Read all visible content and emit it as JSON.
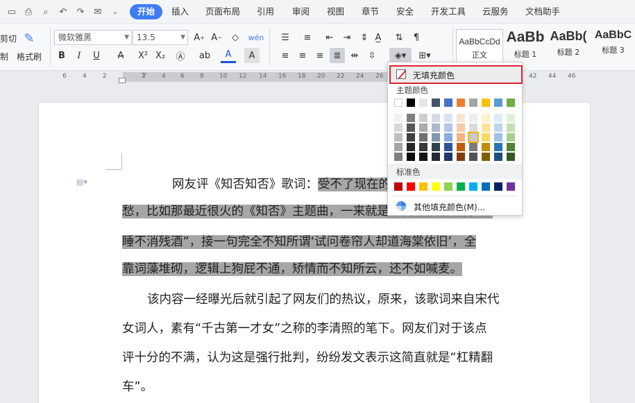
{
  "menubar": {
    "tabs": [
      "开始",
      "插入",
      "页面布局",
      "引用",
      "审阅",
      "视图",
      "章节",
      "安全",
      "开发工具",
      "云服务",
      "文档助手"
    ],
    "active_tab": "开始"
  },
  "ribbon": {
    "clipboard": {
      "cut_label": "剪切",
      "format_painter_label": "格式刷"
    },
    "font": {
      "family": "微软雅黑",
      "size": "13.5"
    },
    "styles": [
      {
        "sample": "AaBbCcDd",
        "name": "正文"
      },
      {
        "sample": "AaBb",
        "name": "标题 1"
      },
      {
        "sample": "AaBb(",
        "name": "标题 2"
      },
      {
        "sample": "AaBbC",
        "name": "标题 3"
      }
    ]
  },
  "ruler": {
    "numbers": [
      "6",
      "4",
      "2",
      "2",
      "4",
      "6",
      "8",
      "10",
      "12",
      "14",
      "16",
      "18",
      "20",
      "22",
      "24",
      "26",
      "28",
      "30",
      "32",
      "34",
      "36",
      "38",
      "40",
      "42",
      "44",
      "46"
    ]
  },
  "document": {
    "lines": [
      "网友评《知否知否》歌词：受不了现在的古风",
      "愁，比如那最近很火的《知否》主题曲，一来就是“昨夜雨疏风骤，浓",
      "睡不消残酒”，接一句完全不知所谓‘试问卷帘人却道海棠依旧’，全",
      "靠词藻堆砌，逻辑上狗屁不通，矫情而不知所云，还不如喊麦。",
      "该内容一经曝光后就引起了网友们的热议，原来，该歌词来自宋代",
      "女词人，素有“千古第一才女”之称的李清照的笔下。网友们对于该点",
      "评十分的不满，认为这是强行批判，纷纷发文表示这简直就是“杠精翻",
      "车”。"
    ]
  },
  "dropdown": {
    "no_fill_label": "无填充颜色",
    "theme_colors_title": "主题颜色",
    "standard_colors_title": "标准色",
    "more_fill_label": "其他填充颜色(M)...",
    "theme_top_row": [
      "#ffffff",
      "#000000",
      "#e7e6e6",
      "#44546a",
      "#4472c4",
      "#ed7d31",
      "#a5a5a5",
      "#ffc000",
      "#5b9bd5",
      "#70ad47"
    ],
    "theme_shades": [
      [
        "#f2f2f2",
        "#7f7f7f",
        "#d0cece",
        "#d6dce4",
        "#d9e2f3",
        "#fbe4d5",
        "#ededed",
        "#fff2cc",
        "#deebf6",
        "#e2efd9"
      ],
      [
        "#d8d8d8",
        "#595959",
        "#aeabab",
        "#adb9ca",
        "#b4c6e7",
        "#f7caac",
        "#dbdbdb",
        "#ffe598",
        "#bdd7ee",
        "#c5e0b3"
      ],
      [
        "#bfbfbf",
        "#3f3f3f",
        "#757070",
        "#8496b0",
        "#8eaadb",
        "#f4b183",
        "#c9c9c9",
        "#ffd965",
        "#9dc3e6",
        "#a8d08d"
      ],
      [
        "#a5a5a5",
        "#262626",
        "#3a3838",
        "#323f4f",
        "#2f5496",
        "#c45911",
        "#7b7b7b",
        "#bf9000",
        "#2e75b5",
        "#538135"
      ],
      [
        "#7f7f7f",
        "#0c0c0c",
        "#171616",
        "#222a35",
        "#1f3864",
        "#833c0b",
        "#525252",
        "#7f6000",
        "#1e4e79",
        "#375623"
      ]
    ],
    "standard_colors": [
      "#c00000",
      "#ff0000",
      "#ffc000",
      "#ffff00",
      "#92d050",
      "#00b050",
      "#00b0f0",
      "#0070c0",
      "#002060",
      "#7030a0"
    ]
  }
}
